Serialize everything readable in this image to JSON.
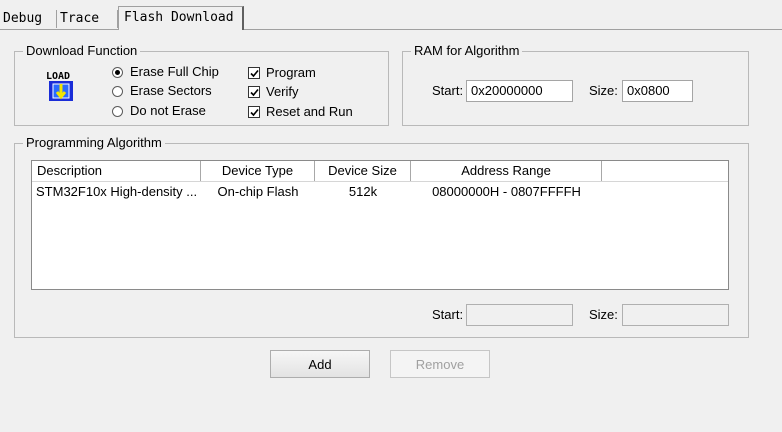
{
  "tabs": [
    {
      "label": "Debug"
    },
    {
      "label": "Trace"
    },
    {
      "label": "Flash Download",
      "active": true
    }
  ],
  "download_function": {
    "title": "Download Function",
    "icon": "load-icon",
    "icon_text": "LOAD",
    "options": [
      {
        "label": "Erase Full Chip",
        "selected": true
      },
      {
        "label": "Erase Sectors",
        "selected": false
      },
      {
        "label": "Do not Erase",
        "selected": false
      }
    ],
    "checks": [
      {
        "label": "Program",
        "checked": true
      },
      {
        "label": "Verify",
        "checked": true
      },
      {
        "label": "Reset and Run",
        "checked": true
      }
    ]
  },
  "ram_algorithm": {
    "title": "RAM for Algorithm",
    "start_label": "Start:",
    "start_value": "0x20000000",
    "size_label": "Size:",
    "size_value": "0x0800"
  },
  "programming_algorithm": {
    "title": "Programming Algorithm",
    "columns": [
      "Description",
      "Device Type",
      "Device Size",
      "Address Range"
    ],
    "rows": [
      [
        "STM32F10x High-density ...",
        "On-chip Flash",
        "512k",
        "08000000H - 0807FFFFH"
      ]
    ],
    "start_label": "Start:",
    "start_value": "",
    "size_label": "Size:",
    "size_value": ""
  },
  "buttons": {
    "add": "Add",
    "remove": "Remove"
  },
  "colors": {
    "background": "#f0f0f0",
    "icon_blue": "#1a2dd8",
    "icon_yellow": "#f2e600"
  }
}
